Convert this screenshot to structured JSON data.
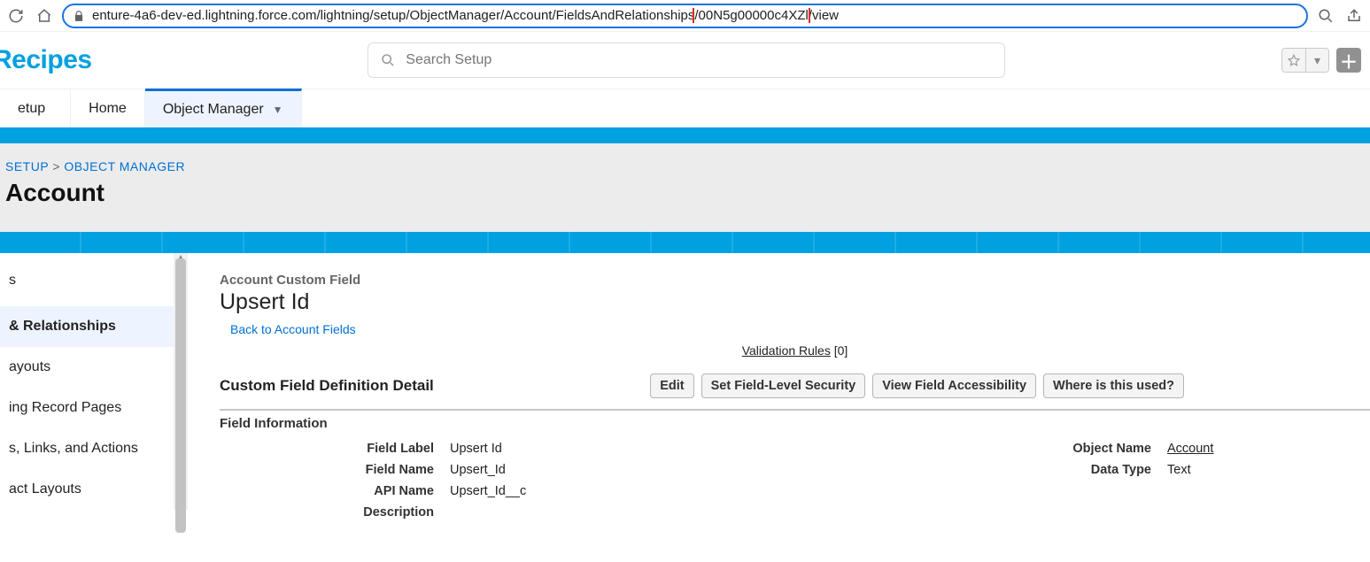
{
  "browser": {
    "url_pre": "enture-4a6-dev-ed.lightning.force.com/lightning/setup/ObjectManager/Account/FieldsAndRelationships",
    "url_hl": "/00N5g00000c4XZl",
    "url_post": "/view"
  },
  "brand": "Recipes",
  "search": {
    "placeholder": "Search Setup"
  },
  "nav": {
    "setup": "etup",
    "home": "Home",
    "object_manager": "Object Manager"
  },
  "breadcrumb": {
    "a": "SETUP",
    "b": "OBJECT MANAGER",
    "title": "Account"
  },
  "sidebar": {
    "items": [
      {
        "label": "s"
      },
      {
        "label": " & Relationships"
      },
      {
        "label": "ayouts"
      },
      {
        "label": "ing Record Pages"
      },
      {
        "label": "s, Links, and Actions"
      },
      {
        "label": "act Layouts"
      }
    ]
  },
  "field": {
    "subtitle": "Account Custom Field",
    "title": "Upsert Id",
    "back": "Back to Account Fields",
    "validation_label": "Validation Rules",
    "validation_count": "[0]",
    "section_title": "Custom Field Definition Detail",
    "buttons": {
      "edit": "Edit",
      "set_fls": "Set Field-Level Security",
      "view_fa": "View Field Accessibility",
      "where_used": "Where is this used?"
    },
    "block_head": "Field Information",
    "left": [
      {
        "lbl": "Field Label",
        "val": "Upsert Id"
      },
      {
        "lbl": "Field Name",
        "val": "Upsert_Id"
      },
      {
        "lbl": "API Name",
        "val": "Upsert_Id__c"
      },
      {
        "lbl": "Description",
        "val": ""
      }
    ],
    "right": [
      {
        "lbl": "Object Name",
        "val": "Account",
        "link": true
      },
      {
        "lbl": "Data Type",
        "val": "Text"
      }
    ]
  }
}
